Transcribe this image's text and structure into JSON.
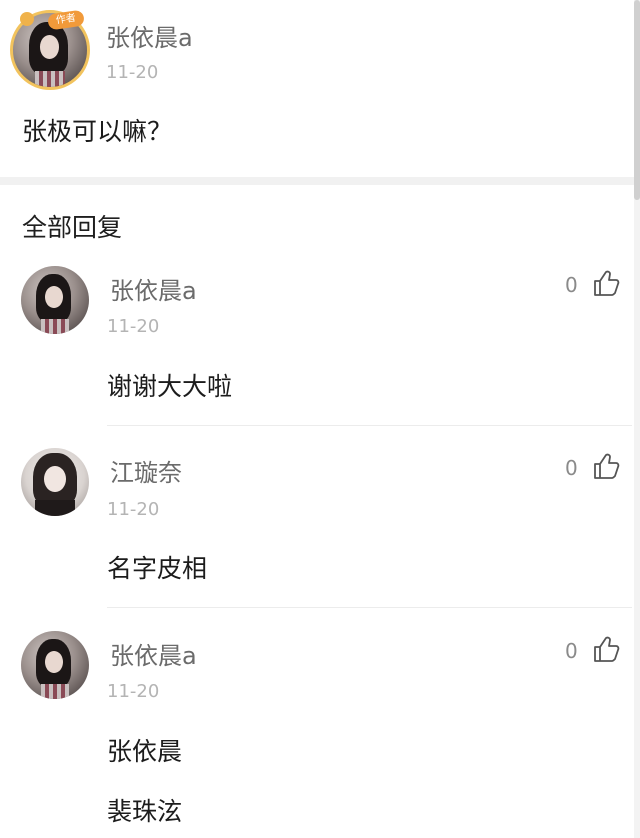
{
  "post": {
    "author": "张依晨a",
    "time": "11-20",
    "badge": "作者",
    "content": "张极可以嘛？"
  },
  "replies_section_title": "全部回复",
  "replies": [
    {
      "author": "张依晨a",
      "time": "11-20",
      "likes": "0",
      "content": [
        "谢谢大大啦"
      ]
    },
    {
      "author": "江璇奈",
      "time": "11-20",
      "likes": "0",
      "content": [
        "名字皮相"
      ]
    },
    {
      "author": "张依晨a",
      "time": "11-20",
      "likes": "0",
      "content": [
        "张依晨",
        "裴珠泫"
      ]
    }
  ],
  "icons": {
    "like": "thumbs-up-icon"
  }
}
